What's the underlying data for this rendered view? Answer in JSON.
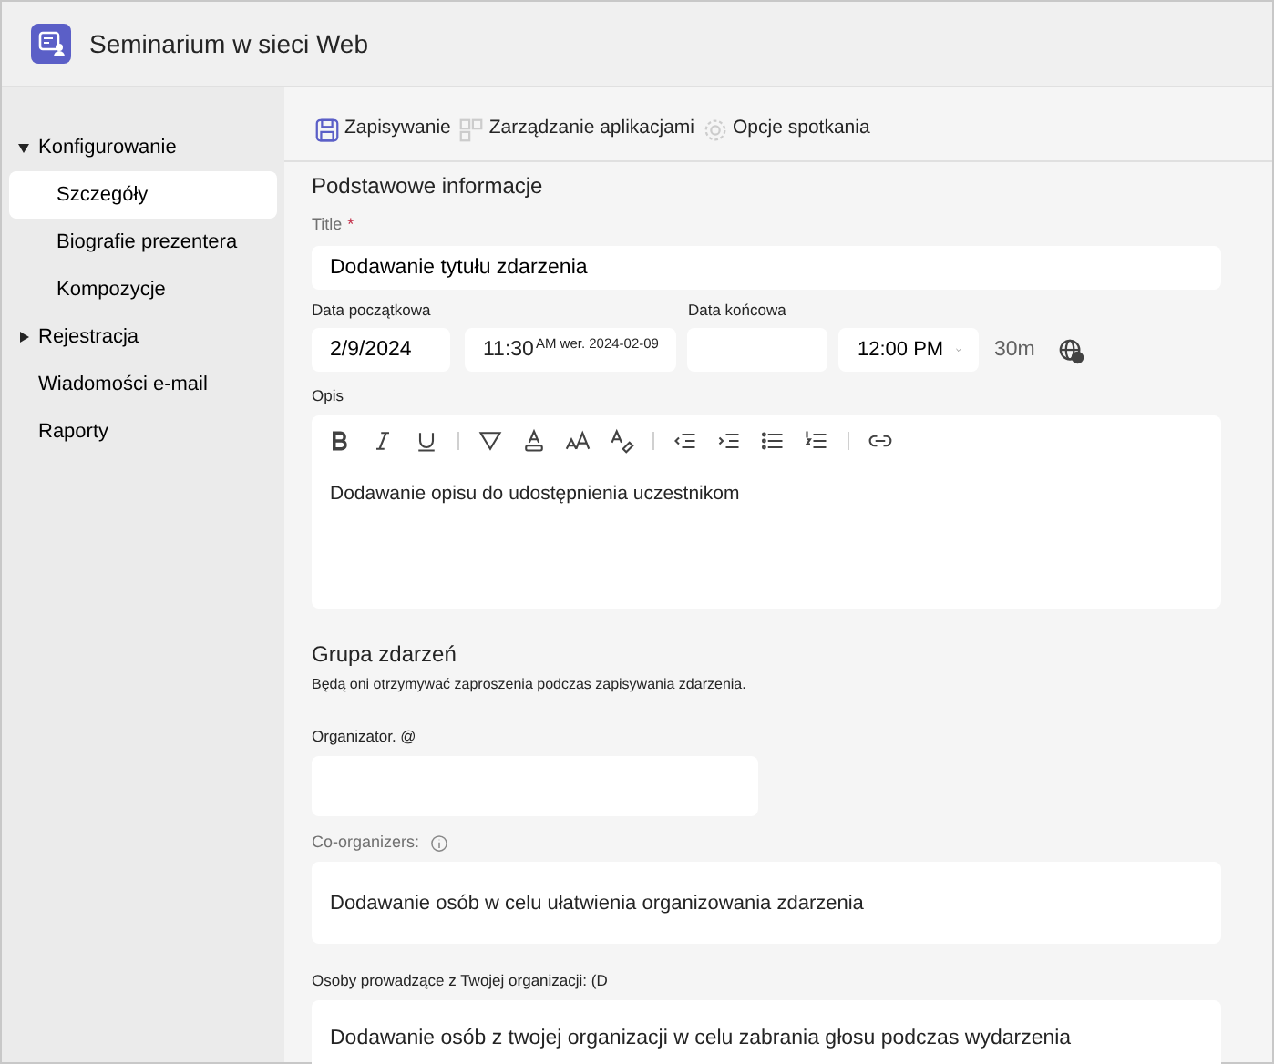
{
  "window": {
    "title": "Seminarium w sieci Web"
  },
  "sidebar": {
    "items": [
      {
        "label": "Konfigurowanie",
        "expanded": true,
        "selected": false,
        "children": [
          {
            "label": "Szczegóły",
            "selected": true
          },
          {
            "label": "Biografie prezentera",
            "selected": false
          },
          {
            "label": "Kompozycje",
            "selected": false
          }
        ]
      },
      {
        "label": "Rejestracja",
        "expanded": false,
        "selected": false
      },
      {
        "label": "Wiadomości e-mail",
        "selected": false
      },
      {
        "label": "Raporty",
        "selected": false
      }
    ]
  },
  "toolbar": [
    {
      "label": "Zapisywanie",
      "kind": "save"
    },
    {
      "label": "Zarządzanie aplikacjami",
      "kind": "apps"
    },
    {
      "label": "Opcje spotkania",
      "kind": "options"
    }
  ],
  "section_title": "Podstawowe informacje",
  "title_field": {
    "label": "Title",
    "required_mark": "*",
    "value": "Dodawanie tytułu zdarzenia"
  },
  "dates": {
    "start_label": "Data początkowa",
    "start_date": "2/9/2024",
    "start_time": "11:30",
    "start_hint": "AM wer. 2024-02-09",
    "end_label": "Data końcowa",
    "end_time": "12:00 PM",
    "duration": "30m"
  },
  "description": {
    "label": "Opis",
    "tools": [
      {
        "kind": "bold"
      },
      {
        "kind": "italic"
      },
      {
        "kind": "underline"
      },
      {
        "kind": "separator"
      },
      {
        "kind": "highlight"
      },
      {
        "kind": "fontcolor"
      },
      {
        "kind": "fontsize"
      },
      {
        "kind": "clear"
      },
      {
        "kind": "separator"
      },
      {
        "kind": "outdent"
      },
      {
        "kind": "indent"
      },
      {
        "kind": "bullets"
      },
      {
        "kind": "numbers"
      },
      {
        "kind": "separator"
      },
      {
        "kind": "link"
      }
    ],
    "value": "Dodawanie opisu do udostępnienia uczestnikom"
  },
  "group": {
    "title": "Grupa zdarzeń",
    "note": "Będą oni otrzymywać zaproszenia podczas zapisywania zdarzenia.",
    "organizer_label": "Organizator. @",
    "coorganizers_label": "Co-organizers:",
    "coorganizers_value": "Dodawanie osób w celu ułatwienia organizowania zdarzenia",
    "presenters_label": "Osoby prowadzące z Twojej organizacji: (D",
    "presenters_value": "Dodawanie osób z twojej organizacji w celu zabrania głosu podczas wydarzenia"
  }
}
